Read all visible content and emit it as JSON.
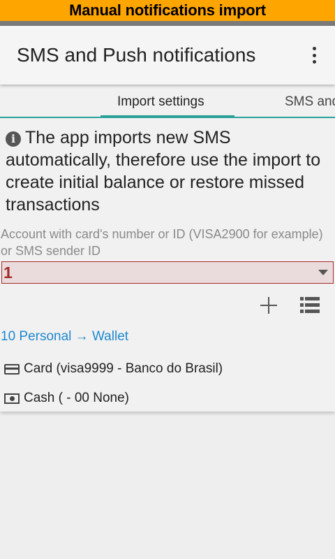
{
  "banner": {
    "title": "Manual notifications import"
  },
  "appbar": {
    "title": "SMS and Push notifications",
    "menu_icon": "more-vert-icon"
  },
  "tabs": [
    {
      "label": "Import settings",
      "active": true
    },
    {
      "label": "SMS and",
      "active": false
    }
  ],
  "info": {
    "icon": "info-icon",
    "text": "The app imports new SMS automatically, therefore use the import to create initial balance or restore missed transactions"
  },
  "account_field": {
    "label": "Account with card's number or ID (VISA2900 for example) or SMS sender ID",
    "value": "1"
  },
  "actions": {
    "add_icon": "plus-icon",
    "list_icon": "list-icon"
  },
  "link": {
    "text": "10 Personal → Wallet"
  },
  "accounts": [
    {
      "icon": "credit-card-icon",
      "label": "Card (visa9999 - Banco do Brasil)"
    },
    {
      "icon": "cash-icon",
      "label": "Cash ( - 00 None)"
    }
  ],
  "colors": {
    "banner": "#ffa500",
    "accent": "#2aa198",
    "link": "#1e88d0",
    "error": "#a52a2a",
    "error_background": "#eadcdc"
  }
}
